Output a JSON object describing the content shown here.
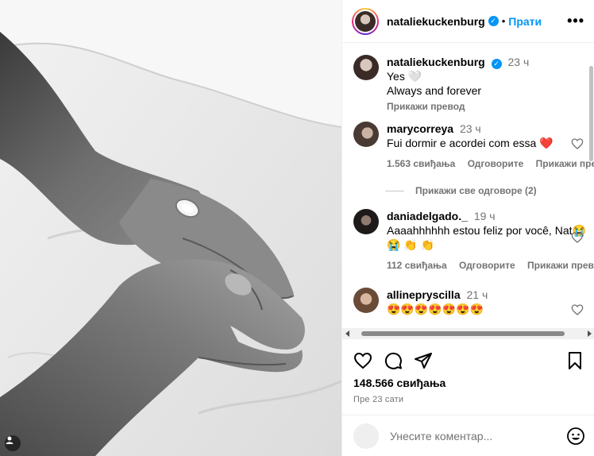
{
  "post": {
    "username": "nataliekuckenburg",
    "follow_label": "Прати",
    "more_label": "•••",
    "dot": "•",
    "verified_glyph": "✓"
  },
  "caption": {
    "username": "nataliekuckenburg",
    "time": "23 ч",
    "line1": "Yes 🤍",
    "line2": "Always and forever",
    "translate": "Прикажи превод"
  },
  "comments": [
    {
      "username": "marycorreya",
      "time": "23 ч",
      "text": "Fui dormir e acordei com essa ❤️",
      "likes": "1.563 свиђања",
      "reply": "Одговорите",
      "translate": "Прикажи превод"
    },
    {
      "username": "dania delgado._",
      "username_display": "daniadelgado._",
      "time": "19 ч",
      "text": "Aaaahhhhhh estou feliz por você, Nat😭 😭 👏 👏",
      "likes": "112 свиђања",
      "reply": "Одговорите",
      "translate": "Прикажи превод"
    },
    {
      "username": "allinepryscilla",
      "time": "21 ч",
      "text": "😍😍😍😍😍😍😍"
    }
  ],
  "replies_label": "Прикажи све одговоре (2)",
  "likes_total": "148.566 свиђања",
  "posted_ago": "Пре 23 сати",
  "comment_placeholder": "Унесите коментар...",
  "colors": {
    "accent": "#0095f6",
    "heart": "#ed4956",
    "muted": "#737373"
  }
}
